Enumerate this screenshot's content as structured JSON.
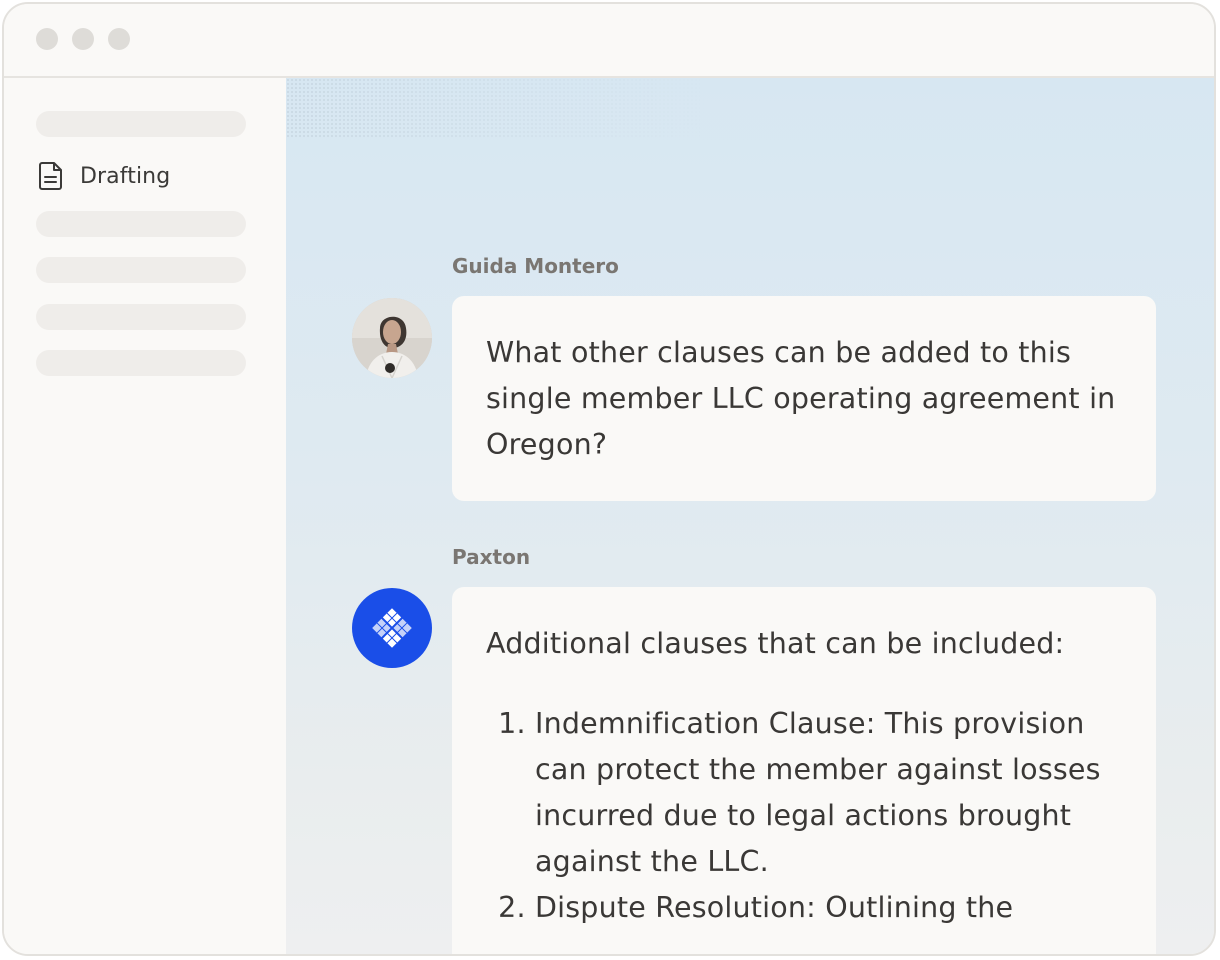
{
  "sidebar": {
    "items": [
      {
        "label": "Drafting",
        "icon": "document-icon"
      }
    ]
  },
  "chat": {
    "messages": [
      {
        "sender": "Guida Montero",
        "text": "What other clauses can be added to this single member LLC operating agreement in Oregon?"
      },
      {
        "sender": "Paxton",
        "intro": "Additional clauses that can be included:",
        "list": [
          "Indemnification Clause: This provision can protect the member against losses incurred due to legal actions brought against the LLC.",
          "Dispute Resolution: Outlining the"
        ]
      }
    ]
  },
  "colors": {
    "brand_blue": "#1a4ee8",
    "window_bg": "#faf9f7",
    "main_bg_top": "#d7e7f2",
    "text": "#3a3836",
    "sender_text": "#7a7672"
  }
}
